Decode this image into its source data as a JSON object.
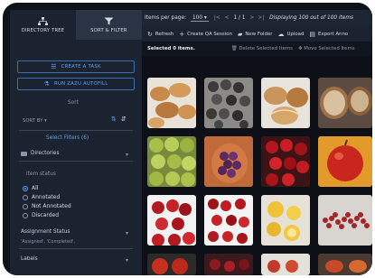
{
  "sidebar": {
    "tabs": [
      {
        "label": "DIRECTORY TREE",
        "icon": "hierarchy-icon"
      },
      {
        "label": "SORT & FILTER",
        "icon": "filter-icon"
      }
    ],
    "create_task_label": "CREATE A TASK",
    "run_autofill_label": "RUN ZAZU AUTOFILL",
    "sort_heading": "Sort",
    "sort_by_label": "SORT BY",
    "select_filters_label": "Select Filters (6)",
    "directories_label": "Directories",
    "item_status_heading": "Item status",
    "item_status_options": [
      "All",
      "Annotated",
      "Not Annotated",
      "Discarded"
    ],
    "item_status_selected": "All",
    "assignment_status_label": "Assignment Status",
    "assignment_status_value": "'Assigned', 'Completed',",
    "labels_label": "Labels"
  },
  "topbar": {
    "items_per_page_label": "Items per page:",
    "items_per_page_value": "100",
    "page_indicator": "1 / 1",
    "display_summary": "Displaying 100 out of 100 items"
  },
  "toolbar": {
    "refresh_label": "Refresh",
    "create_qa_label": "Create QA Session",
    "new_folder_label": "New Folder",
    "upload_label": "Upload",
    "export_label": "Export Anno"
  },
  "selection": {
    "selected_label": "Selected 0 items.",
    "delete_label": "Delete Selected Items",
    "move_label": "Move Selected Items"
  },
  "colors": {
    "sidebar_bg": "#1b2230",
    "accent": "#5fa0ee",
    "main_bg": "#0d1016"
  },
  "grid": {
    "tiles": [
      {
        "name": "bread-rolls-image"
      },
      {
        "name": "dark-berries-image"
      },
      {
        "name": "bread-loaves-image"
      },
      {
        "name": "sliced-bread-image"
      },
      {
        "name": "green-fruits-image"
      },
      {
        "name": "purple-grapes-image"
      },
      {
        "name": "red-cherries-image"
      },
      {
        "name": "red-apple-image"
      },
      {
        "name": "cherries-tray-image"
      },
      {
        "name": "cherries-closeup-image"
      },
      {
        "name": "lemons-image"
      },
      {
        "name": "red-beans-image"
      }
    ]
  }
}
